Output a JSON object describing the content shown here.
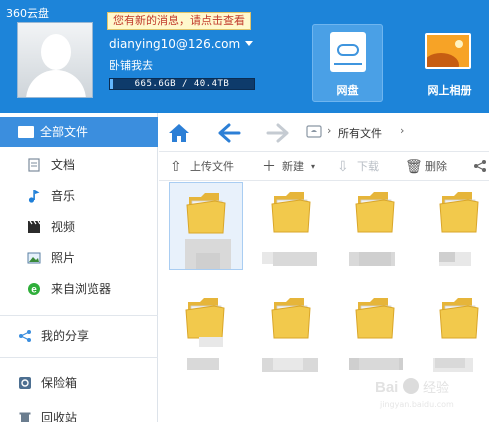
{
  "app": {
    "title": "360云盘"
  },
  "header": {
    "notice": "您有新的消息，请点击查看",
    "email": "dianying10@126.com",
    "username": "卧铺我去",
    "quota": {
      "text": "665.6GB / 40.4TB",
      "used_fraction": 0.016
    },
    "nav": [
      {
        "label": "网盘",
        "icon": "cloud-disk-icon",
        "active": true
      },
      {
        "label": "网上相册",
        "icon": "photo-album-icon",
        "active": false
      }
    ]
  },
  "sidebar": {
    "all_files": "全部文件",
    "categories": [
      {
        "label": "文档",
        "icon": "document-icon"
      },
      {
        "label": "音乐",
        "icon": "music-icon"
      },
      {
        "label": "视频",
        "icon": "video-icon"
      },
      {
        "label": "照片",
        "icon": "photo-icon"
      },
      {
        "label": "来自浏览器",
        "icon": "browser-icon"
      }
    ],
    "share": "我的分享",
    "vault": "保险箱",
    "recycle": "回收站"
  },
  "toolbar": {
    "path_label": "所有文件",
    "upload": "上传文件",
    "new": "新建",
    "download": "下载",
    "delete": "删除"
  },
  "files": [
    {
      "name": "",
      "icon": "folder-icon",
      "selected": true
    },
    {
      "name": "",
      "icon": "folder-icon",
      "selected": false
    },
    {
      "name": "",
      "icon": "folder-icon",
      "selected": false
    },
    {
      "name": "",
      "icon": "folder-icon",
      "selected": false
    },
    {
      "name": "",
      "icon": "folder-icon",
      "selected": false
    },
    {
      "name": "",
      "icon": "folder-icon",
      "selected": false
    },
    {
      "name": "",
      "icon": "folder-icon",
      "selected": false
    },
    {
      "name": "",
      "icon": "folder-icon",
      "selected": false
    }
  ],
  "watermark": {
    "text": "Bai 百度 经验",
    "sub": "jingyan.baidu.com"
  },
  "colors": {
    "header": "#1d84d9",
    "accent": "#3b8ede",
    "folder": "#f1c74a"
  }
}
